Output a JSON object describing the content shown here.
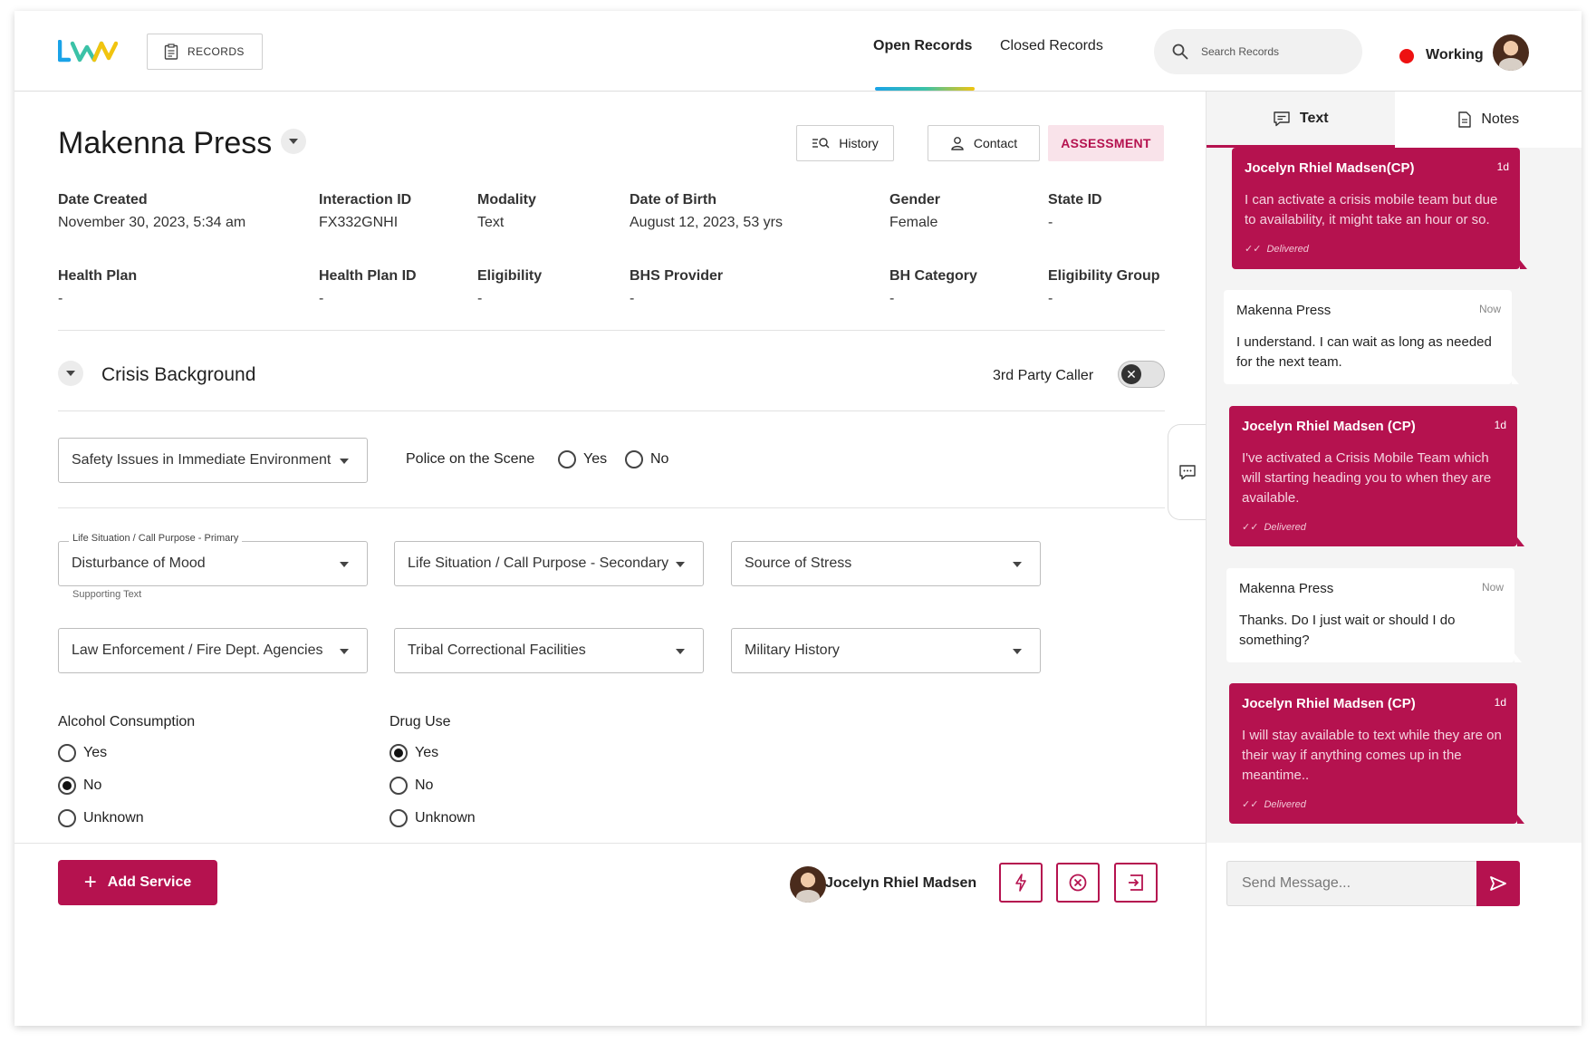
{
  "header": {
    "records_label": "RECORDS",
    "tabs": [
      "Open Records",
      "Closed Records"
    ],
    "search_placeholder": "Search Records",
    "status": "Working",
    "accent": "#b5124f"
  },
  "record": {
    "name": "Makenna Press",
    "buttons": {
      "history": "History",
      "contact": "Contact",
      "assessment": "ASSESSMENT"
    },
    "fields_row1": [
      {
        "label": "Date Created",
        "value": "November 30, 2023, 5:34 am"
      },
      {
        "label": "Interaction ID",
        "value": "FX332GNHI"
      },
      {
        "label": "Modality",
        "value": "Text"
      },
      {
        "label": "Date of Birth",
        "value": "August 12, 2023, 53 yrs"
      },
      {
        "label": "Gender",
        "value": "Female"
      },
      {
        "label": "State ID",
        "value": "-"
      }
    ],
    "fields_row2": [
      {
        "label": "Health Plan",
        "value": "-"
      },
      {
        "label": "Health Plan ID",
        "value": "-"
      },
      {
        "label": "Eligibility",
        "value": "-"
      },
      {
        "label": "BHS Provider",
        "value": "-"
      },
      {
        "label": "BH Category",
        "value": "-"
      },
      {
        "label": "Eligibility Group",
        "value": "-"
      }
    ]
  },
  "crisis": {
    "title": "Crisis Background",
    "third_party_label": "3rd Party Caller",
    "safety_select": "Safety Issues in Immediate Environment",
    "police_label": "Police on the Scene",
    "police_options": [
      "Yes",
      "No"
    ],
    "primary_float_label": "Life Situation / Call Purpose - Primary",
    "primary_value": "Disturbance of Mood",
    "supporting_text": "Supporting Text",
    "secondary_select": "Life Situation / Call Purpose - Secondary",
    "stress_select": "Source of Stress",
    "law_select": "Law Enforcement / Fire Dept. Agencies",
    "tribal_select": "Tribal Correctional Facilities",
    "military_select": "Military History",
    "alcohol": {
      "title": "Alcohol Consumption",
      "options": [
        "Yes",
        "No",
        "Unknown"
      ],
      "selected": "No"
    },
    "drug": {
      "title": "Drug Use",
      "options": [
        "Yes",
        "No",
        "Unknown"
      ],
      "selected": "Yes"
    }
  },
  "footer": {
    "add_service": "Add Service",
    "agent_name": "Jocelyn Rhiel Madsen"
  },
  "chat": {
    "tabs": [
      "Text",
      "Notes"
    ],
    "messages": [
      {
        "from": "Jocelyn Rhiel Madsen(CP)",
        "time": "1d",
        "text": "I can activate a crisis mobile team but due to availability, it might take an hour or so.",
        "status": "Delivered",
        "dir": "out"
      },
      {
        "from": "Makenna Press",
        "time": "Now",
        "text": "I understand. I can wait as long as needed for the next team.",
        "dir": "in"
      },
      {
        "from": "Jocelyn Rhiel Madsen (CP)",
        "time": "1d",
        "text": "I've activated a Crisis Mobile Team which will starting heading you to when they are available.",
        "status": "Delivered",
        "dir": "out"
      },
      {
        "from": "Makenna Press",
        "time": "Now",
        "text": "Thanks. Do I just wait or should I do something?",
        "dir": "in"
      },
      {
        "from": "Jocelyn Rhiel Madsen (CP)",
        "time": "1d",
        "text": "I will stay available to text while they are on their way if anything comes up in the meantime..",
        "status": "Delivered",
        "dir": "out"
      }
    ],
    "input_placeholder": "Send Message..."
  }
}
